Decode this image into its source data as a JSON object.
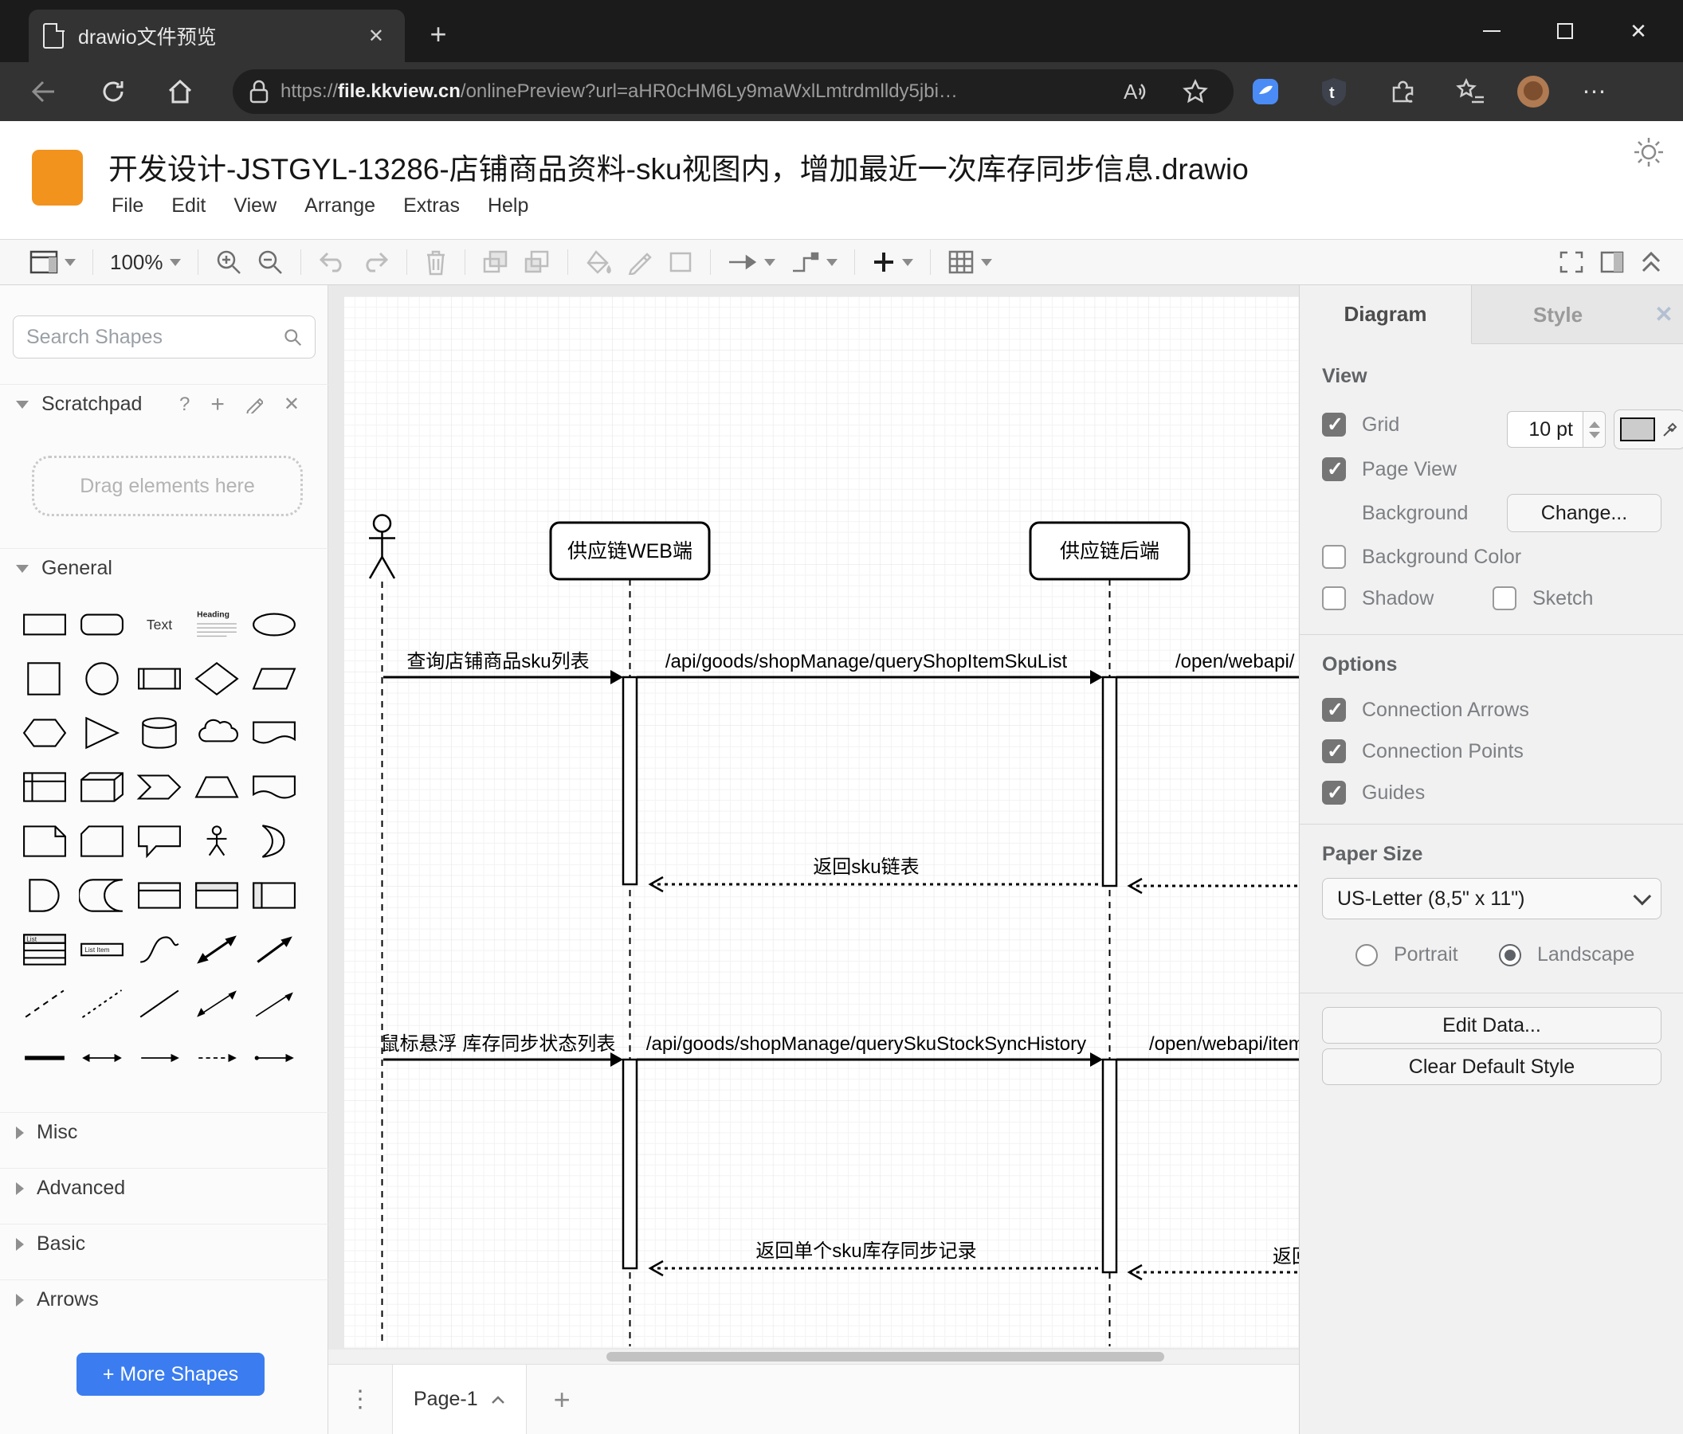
{
  "browser": {
    "tab_title": "drawio文件预览",
    "url_prefix": "https://",
    "url_host": "file.kkview.cn",
    "url_path": "/onlinePreview?url=aHR0cHM6Ly9maWxlLmtrdmlldy5jbi…",
    "read_aloud_label": "A"
  },
  "app": {
    "file_title": "开发设计-JSTGYL-13286-店铺商品资料-sku视图内，增加最近一次库存同步信息.drawio",
    "menus": [
      "File",
      "Edit",
      "View",
      "Arrange",
      "Extras",
      "Help"
    ],
    "zoom_level": "100%"
  },
  "sidebar": {
    "search_placeholder": "Search Shapes",
    "scratchpad_label": "Scratchpad",
    "scratchpad_hint": "Drag elements here",
    "sections": {
      "general": "General",
      "misc": "Misc",
      "advanced": "Advanced",
      "basic": "Basic",
      "arrows": "Arrows"
    },
    "more_shapes_label": "+ More Shapes",
    "shapes": [
      "rectangle",
      "rounded-rectangle",
      "text",
      "heading",
      "ellipse",
      "square",
      "circle",
      "process",
      "diamond",
      "parallelogram",
      "hexagon",
      "triangle",
      "cylinder",
      "cloud",
      "document",
      "internal-storage",
      "cube",
      "step",
      "trapezoid",
      "tape",
      "note",
      "card",
      "callout",
      "actor",
      "or",
      "and",
      "data-storage",
      "container",
      "vertical-container",
      "horizontal-container",
      "list",
      "list-item",
      "curve",
      "bidirectional-arrow",
      "arrow",
      "dashed-line",
      "dotted-line",
      "line",
      "bidirectional-connector",
      "directional-connector",
      "horizontal-line",
      "horizontal-double-arrow",
      "horizontal-arrow",
      "dashed-horizontal-arrow",
      "link-arrow"
    ],
    "shape_labels": {
      "text": "Text",
      "heading": "Heading",
      "list": "List",
      "list-item": "List Item"
    }
  },
  "canvas": {
    "lifelines": [
      "供应链WEB端",
      "供应链后端"
    ],
    "messages": {
      "m1": "查询店铺商品sku列表",
      "m2": "/api/goods/shopManage/queryShopItemSkuList",
      "m3": "/open/webapi/",
      "r1": "返回sku链表",
      "m4": "鼠标悬浮 库存同步状态列表",
      "m5": "/api/goods/shopManage/querySkuStockSyncHistory",
      "m6": "/open/webapi/item",
      "r2": "返回单个sku库存同步记录",
      "r3": "返回"
    },
    "page_tab": "Page-1"
  },
  "panel": {
    "tabs": {
      "diagram": "Diagram",
      "style": "Style"
    },
    "view": {
      "heading": "View",
      "grid": "Grid",
      "grid_size": "10 pt",
      "page_view": "Page View",
      "background": "Background",
      "change": "Change...",
      "background_color": "Background Color",
      "shadow": "Shadow",
      "sketch": "Sketch"
    },
    "options": {
      "heading": "Options",
      "connection_arrows": "Connection Arrows",
      "connection_points": "Connection Points",
      "guides": "Guides"
    },
    "paper": {
      "heading": "Paper Size",
      "size": "US-Letter (8,5\" x 11\")",
      "portrait": "Portrait",
      "landscape": "Landscape"
    },
    "buttons": {
      "edit_data": "Edit Data...",
      "clear_default_style": "Clear Default Style"
    }
  },
  "colors": {
    "accent_blue": "#3b7df0",
    "logo_orange": "#f2931e",
    "chrome_dark": "#1b1b1b",
    "toolbar_dark": "#333333"
  }
}
